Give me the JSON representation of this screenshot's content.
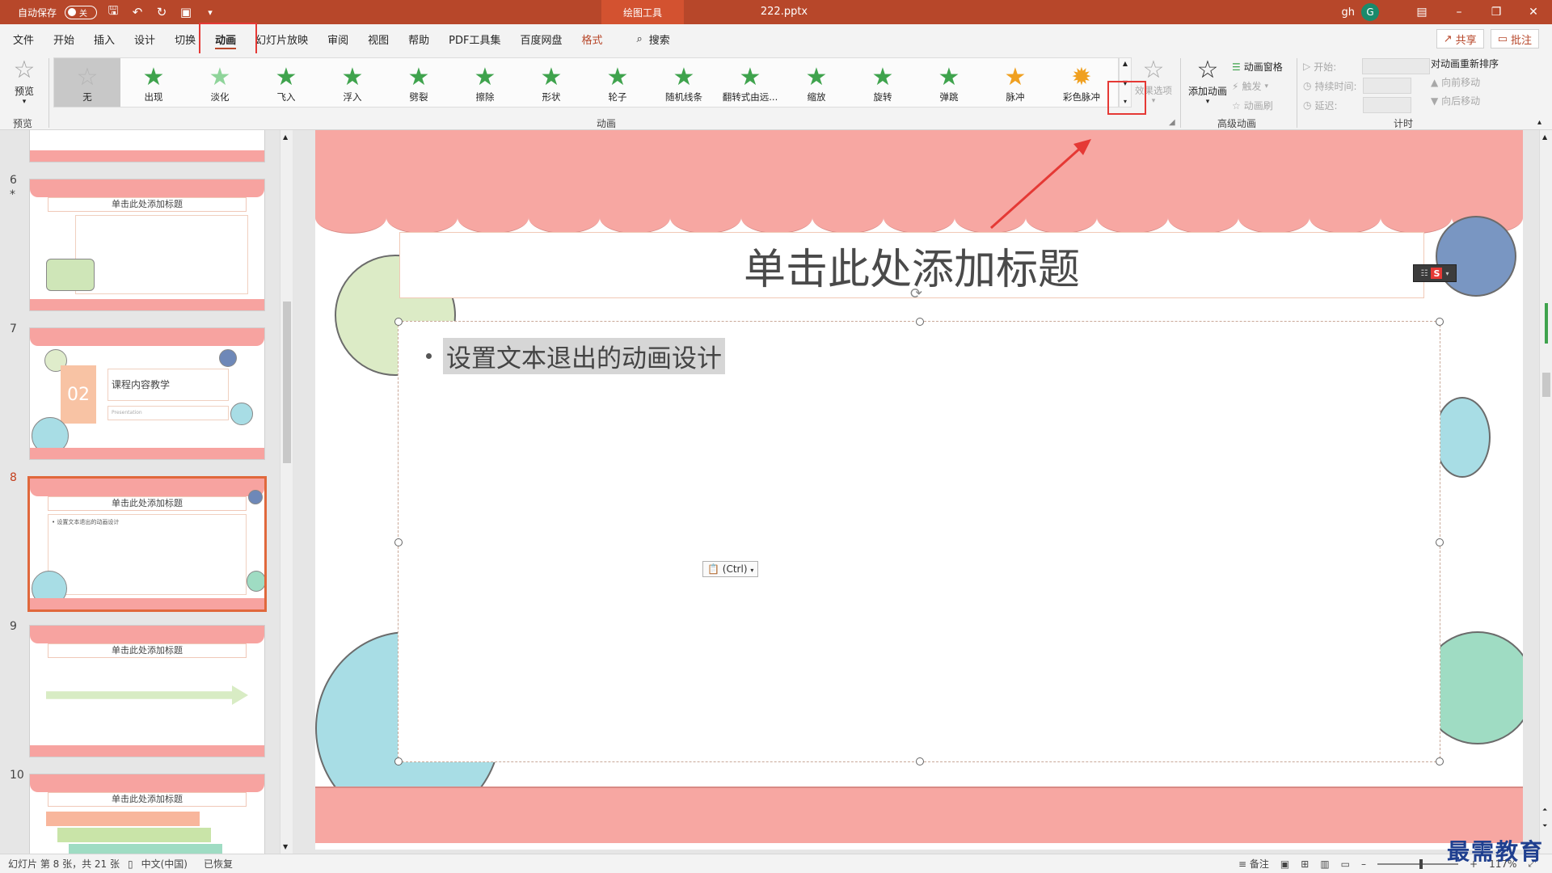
{
  "titlebar": {
    "autosave_label": "自动保存",
    "autosave_state": "关",
    "context_tab": "绘图工具",
    "filename": "222.pptx",
    "user": "gh",
    "avatar_initial": "G"
  },
  "menu": {
    "tabs": [
      "文件",
      "开始",
      "插入",
      "设计",
      "切换",
      "动画",
      "幻灯片放映",
      "审阅",
      "视图",
      "帮助",
      "PDF工具集",
      "百度网盘",
      "格式"
    ],
    "active_tab": "动画",
    "search_label": "搜索",
    "share_label": "共享",
    "comment_label": "批注"
  },
  "ribbon": {
    "preview_label": "预览",
    "preview_group": "预览",
    "animation_group": "动画",
    "animations": [
      {
        "label": "无",
        "icon": "star-outline-icon"
      },
      {
        "label": "出现",
        "icon": "star-icon"
      },
      {
        "label": "淡化",
        "icon": "star-icon"
      },
      {
        "label": "飞入",
        "icon": "star-icon"
      },
      {
        "label": "浮入",
        "icon": "star-icon"
      },
      {
        "label": "劈裂",
        "icon": "star-icon"
      },
      {
        "label": "擦除",
        "icon": "star-icon"
      },
      {
        "label": "形状",
        "icon": "star-icon"
      },
      {
        "label": "轮子",
        "icon": "star-icon"
      },
      {
        "label": "随机线条",
        "icon": "star-icon"
      },
      {
        "label": "翻转式由远...",
        "icon": "star-icon"
      },
      {
        "label": "缩放",
        "icon": "star-icon"
      },
      {
        "label": "旋转",
        "icon": "star-icon"
      },
      {
        "label": "弹跳",
        "icon": "star-icon"
      },
      {
        "label": "脉冲",
        "icon": "star-gold-icon"
      },
      {
        "label": "彩色脉冲",
        "icon": "star-gold-icon"
      }
    ],
    "effect_options_label": "效果选项",
    "advanced_group": "高级动画",
    "add_animation_label": "添加动画",
    "animation_pane_label": "动画窗格",
    "trigger_label": "触发",
    "animation_painter_label": "动画刷",
    "timing_group": "计时",
    "start_label": "开始:",
    "duration_label": "持续时间:",
    "delay_label": "延迟:",
    "reorder_label": "对动画重新排序",
    "move_earlier_label": "向前移动",
    "move_later_label": "向后移动"
  },
  "thumbnails": [
    {
      "num": "6",
      "title": "单击此处添加标题",
      "marker": "*"
    },
    {
      "num": "7",
      "title": "课程内容教学",
      "badge": "02",
      "sub": "Presentation"
    },
    {
      "num": "8",
      "title": "单击此处添加标题",
      "body": "• 设置文本退出的动画设计"
    },
    {
      "num": "9",
      "title": "单击此处添加标题"
    },
    {
      "num": "10",
      "title": "单击此处添加标题"
    }
  ],
  "slide": {
    "title": "单击此处添加标题",
    "bullet": "设置文本退出的动画设计",
    "paste_tag": "(Ctrl)"
  },
  "statusbar": {
    "slide_info": "幻灯片 第 8 张，共 21 张",
    "language": "中文(中国)",
    "recovered": "已恢复",
    "notes_label": "备注",
    "zoom": "117%"
  },
  "watermark": "最需教育",
  "colors": {
    "accent": "#b7472a",
    "slide_pink": "#f7a7a2",
    "highlight_red": "#e53935"
  }
}
